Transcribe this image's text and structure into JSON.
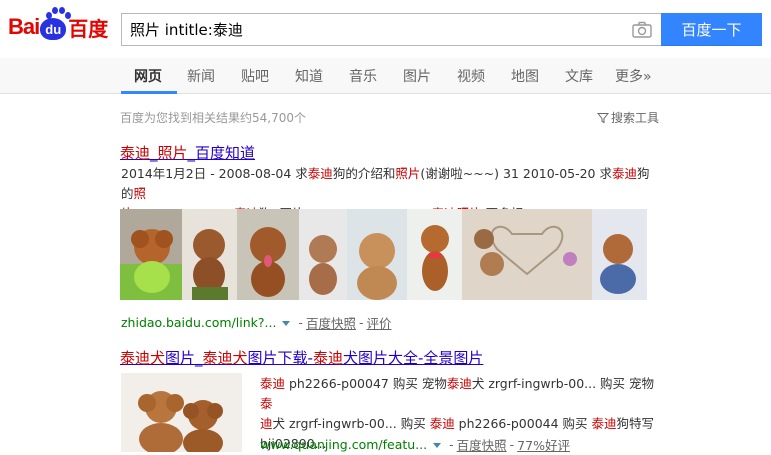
{
  "logo": {
    "bai": "Bai",
    "du": "du",
    "cn": "百度"
  },
  "search": {
    "query": "照片 intitle:泰迪",
    "button": "百度一下"
  },
  "nav": [
    "网页",
    "新闻",
    "贴吧",
    "知道",
    "音乐",
    "图片",
    "视频",
    "地图",
    "文库",
    "更多»"
  ],
  "nav_active": "网页",
  "result_count": "百度为您找到相关结果约54,700个",
  "search_tools": "搜索工具",
  "results": [
    {
      "title_parts": [
        "泰迪",
        "_",
        "照片",
        "_百度知道"
      ],
      "abstract_line1": [
        "2014年1月2日 - 2008-08-04 求",
        "泰迪",
        "狗的介绍和",
        "照片",
        "(谢谢啦~~~) 31 2010-05-20 求",
        "泰迪",
        "狗的",
        "照"
      ],
      "abstract_line2": [
        "片",
        " 13 2013-02-21 ",
        "泰迪",
        "狗..图片。。 105 2013-08-27 ",
        "泰迪照片",
        " 更多相..."
      ],
      "url": "zhidao.baidu.com/link?...",
      "cache": "百度快照",
      "extra": "评价"
    },
    {
      "title_parts": [
        "泰迪犬",
        "图片_",
        "泰迪犬",
        "图片下载-",
        "泰迪",
        "犬图片大全-全景图片"
      ],
      "abstract_line1": [
        "泰迪",
        " ph2266-p00047 购买 宠物",
        "泰迪",
        "犬 zrgrf-ingwrb-00... 购买 宠物",
        "泰"
      ],
      "abstract_line2": [
        "迪",
        "犬 zrgrf-ingwrb-00... 购买 ",
        "泰迪",
        " ph2266-p00044 购买 ",
        "泰迪",
        "狗特写"
      ],
      "abstract_line3": [
        "bji02890..."
      ],
      "url": "www.quanjing.com/featu...",
      "cache": "百度快照",
      "extra": "77%好评"
    }
  ],
  "colors": {
    "accent": "#3385ff",
    "title": "#2000cc",
    "em": "#cc0000",
    "url": "#008000",
    "logo_red": "#e10602",
    "logo_blue": "#2932e1"
  }
}
